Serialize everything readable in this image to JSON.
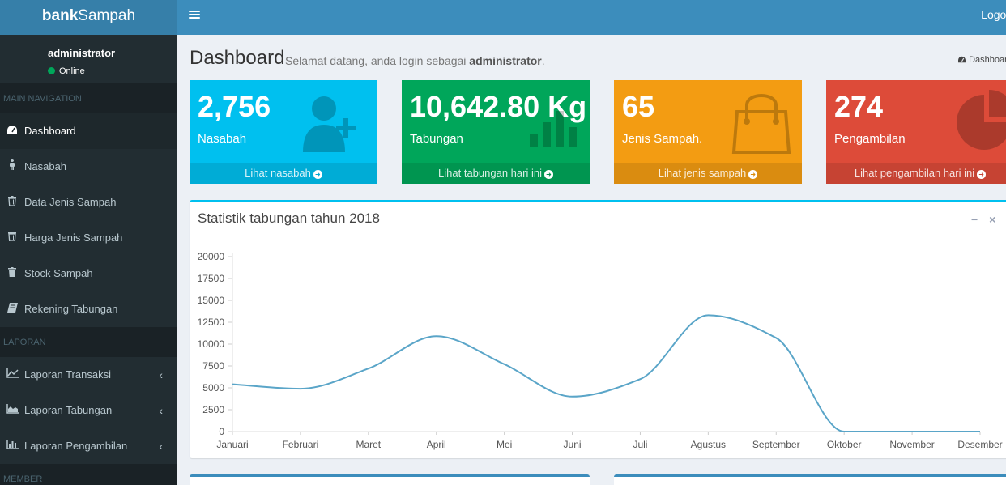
{
  "header": {
    "brand_bold": "bank",
    "brand_light": "Sampah",
    "logout": "Logout"
  },
  "sidebar": {
    "user": {
      "name": "administrator",
      "status": "Online"
    },
    "sections": [
      {
        "header": "MAIN NAVIGATION"
      },
      {
        "header": "LAPORAN"
      },
      {
        "header": "MEMBER"
      }
    ],
    "items": [
      {
        "label": "Dashboard",
        "icon": "dashboard-icon"
      },
      {
        "label": "Nasabah",
        "icon": "user-icon"
      },
      {
        "label": "Data Jenis Sampah",
        "icon": "trash-icon"
      },
      {
        "label": "Harga Jenis Sampah",
        "icon": "trash-icon"
      },
      {
        "label": "Stock Sampah",
        "icon": "trash-icon"
      },
      {
        "label": "Rekening Tabungan",
        "icon": "book-icon"
      },
      {
        "label": "Laporan Transaksi",
        "icon": "line-chart-icon"
      },
      {
        "label": "Laporan Tabungan",
        "icon": "area-chart-icon"
      },
      {
        "label": "Laporan Pengambilan",
        "icon": "bar-chart-icon"
      }
    ]
  },
  "page": {
    "title": "Dashboard",
    "subtitle_prefix": "Selamat datang, anda login sebagai",
    "subtitle_user": "administrator",
    "subtitle_suffix": ".",
    "breadcrumb": "Dashboard"
  },
  "stats": [
    {
      "value": "2,756",
      "label": "Nasabah",
      "link": "Lihat nasabah",
      "color": "#00c0ef",
      "icon": "person-add-icon"
    },
    {
      "value": "10,642.80 Kg",
      "label": "Tabungan",
      "link": "Lihat tabungan hari ini",
      "color": "#00a65a",
      "icon": "stats-bars-icon"
    },
    {
      "value": "65",
      "label": "Jenis Sampah.",
      "link": "Lihat jenis sampah",
      "color": "#f39c12",
      "icon": "bag-icon"
    },
    {
      "value": "274",
      "label": "Pengambilan",
      "link": "Lihat pengambilan hari ini",
      "color": "#dd4b39",
      "icon": "pie-graph-icon"
    }
  ],
  "chart_box": {
    "title": "Statistik tabungan tahun 2018",
    "collapse": "−",
    "close": "×"
  },
  "chart_data": {
    "type": "line",
    "title": "Statistik tabungan tahun 2018",
    "categories": [
      "Januari",
      "Februari",
      "Maret",
      "April",
      "Mei",
      "Juni",
      "Juli",
      "Agustus",
      "September",
      "Oktober",
      "November",
      "Desember"
    ],
    "series": [
      {
        "values": [
          5400,
          4900,
          7200,
          10900,
          7700,
          4000,
          6000,
          13300,
          10700,
          0,
          0,
          0
        ],
        "color": "#5aa5c8"
      }
    ],
    "yticks": [
      0,
      2500,
      5000,
      7500,
      10000,
      12500,
      15000,
      17500,
      20000
    ],
    "ylim": [
      0,
      20000
    ],
    "grid": false
  }
}
